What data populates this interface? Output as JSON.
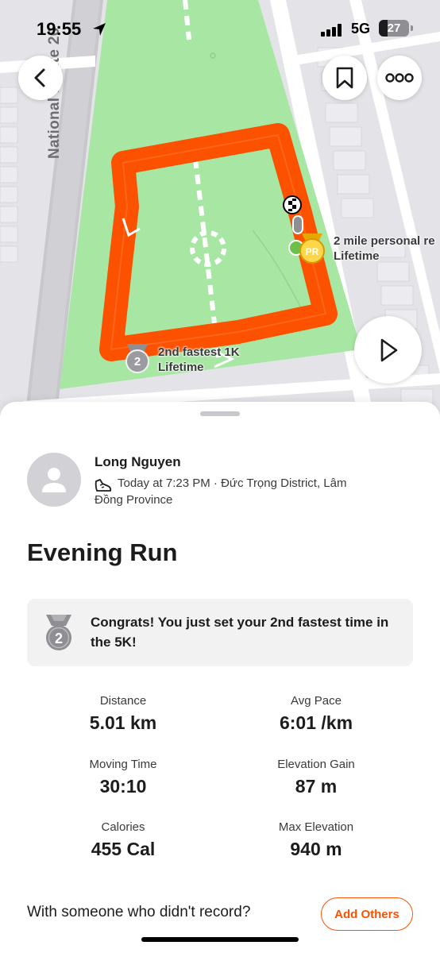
{
  "status_bar": {
    "time": "19:55",
    "network": "5G",
    "battery": "27"
  },
  "map": {
    "road_name": "National Route 20",
    "pr_badge": "PR",
    "pr_label_line1": "2 mile personal re",
    "pr_label_line2": "Lifetime",
    "medal_badge": "2",
    "second_label_line1": "2nd fastest 1K",
    "second_label_line2": "Lifetime",
    "route_color": "#fc5200",
    "park_color": "#a8e6a4"
  },
  "athlete": {
    "name": "Long Nguyen",
    "meta": "Today at 7:23 PM · Đức Trọng District, Lâm Đồng Province",
    "activity_icon": "shoe-icon"
  },
  "activity": {
    "title": "Evening Run"
  },
  "congrats": {
    "medal": "2",
    "message": "Congrats! You just set your 2nd fastest time in the 5K!"
  },
  "stats": [
    {
      "label": "Distance",
      "value": "5.01 km"
    },
    {
      "label": "Avg Pace",
      "value": "6:01 /km"
    },
    {
      "label": "Moving Time",
      "value": "30:10"
    },
    {
      "label": "Elevation Gain",
      "value": "87 m"
    },
    {
      "label": "Calories",
      "value": "455 Cal"
    },
    {
      "label": "Max Elevation",
      "value": "940 m"
    }
  ],
  "footer": {
    "prompt": "With someone who didn't record?",
    "add_others_label": "Add Others"
  },
  "colors": {
    "accent": "#fc5200"
  }
}
